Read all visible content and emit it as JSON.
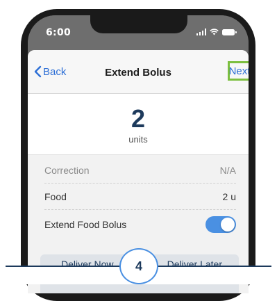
{
  "status_bar": {
    "time": "6:00"
  },
  "navbar": {
    "back_label": "Back",
    "title": "Extend Bolus",
    "next_label": "Next"
  },
  "bolus": {
    "units_value": "2",
    "units_label": "units"
  },
  "rows": [
    {
      "label": "Correction",
      "value": "N/A"
    },
    {
      "label": "Food",
      "value": "2 u"
    },
    {
      "label": "Extend Food Bolus",
      "toggle_on": true
    }
  ],
  "deliver": {
    "now_label": "Deliver Now",
    "later_label": "Deliver Later"
  },
  "step": {
    "number": "4"
  },
  "colors": {
    "accent_blue": "#2d6fd6",
    "highlight_green": "#7cbf3f",
    "navy": "#1d3a5c"
  }
}
